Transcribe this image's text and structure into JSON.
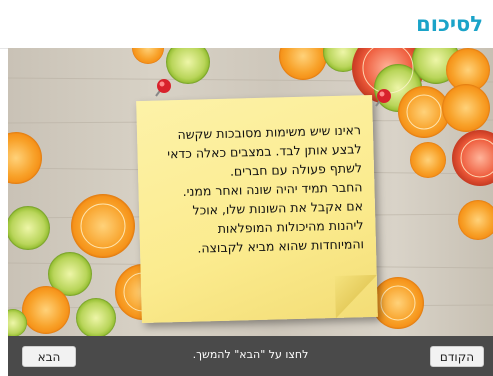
{
  "header": {
    "title": "לסיכום"
  },
  "note": {
    "lines": [
      "ראינו שיש משימות מסובכות שקשה",
      "לבצע אותן לבד. במצבים כאלה כדאי",
      "לשתף פעולה עם חברים.",
      "החבר תמיד יהיה שונה ואחר ממני.",
      "אם אקבל את השונות שלו, אוכל",
      "ליהנות מהיכולות המופלאות",
      "והמיוחדות שהוא מביא לקבוצה."
    ]
  },
  "footer": {
    "next_label": "הבא",
    "hint": "לחצו על \"הבא\" להמשך.",
    "prev_label": "הקודם"
  },
  "colors": {
    "title": "#1aa3c8",
    "note": "#fbeb8e",
    "footer_bg": "#4a4a4a",
    "pin": "#d8222c"
  }
}
